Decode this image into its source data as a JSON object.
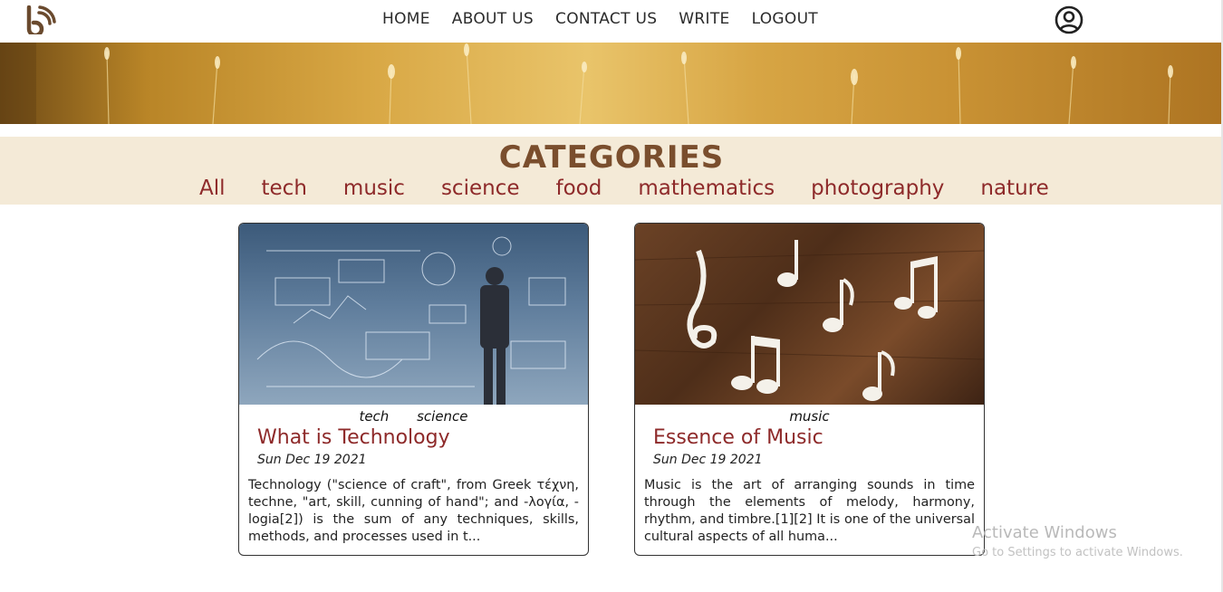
{
  "nav": {
    "items": [
      "HOME",
      "ABOUT US",
      "CONTACT US",
      "WRITE",
      "LOGOUT"
    ]
  },
  "icons": {
    "logo": "blog-rss-icon",
    "avatar": "user-circle-icon"
  },
  "colors": {
    "accent": "#8e2a2a",
    "heading": "#7a4e2d",
    "category_bg": "#f4ead7"
  },
  "categories": {
    "title": "CATEGORIES",
    "items": [
      "All",
      "tech",
      "music",
      "science",
      "food",
      "mathematics",
      "photography",
      "nature"
    ]
  },
  "posts": [
    {
      "tags": [
        "tech",
        "science"
      ],
      "title": "What is Technology",
      "date": "Sun Dec 19 2021",
      "excerpt": "Technology (\"science of craft\", from Greek τέχνη, techne, \"art, skill, cunning of hand\"; and -λογία, -logia[2]) is the sum of any techniques, skills, methods, and processes used in t..."
    },
    {
      "tags": [
        "music"
      ],
      "title": "Essence of Music",
      "date": "Sun Dec 19 2021",
      "excerpt": "Music is the art of arranging sounds in time through the elements of melody, harmony, rhythm, and timbre.[1][2] It is one of the universal cultural aspects of all huma..."
    }
  ],
  "watermark": {
    "line1": "Activate Windows",
    "line2": "Go to Settings to activate Windows."
  }
}
